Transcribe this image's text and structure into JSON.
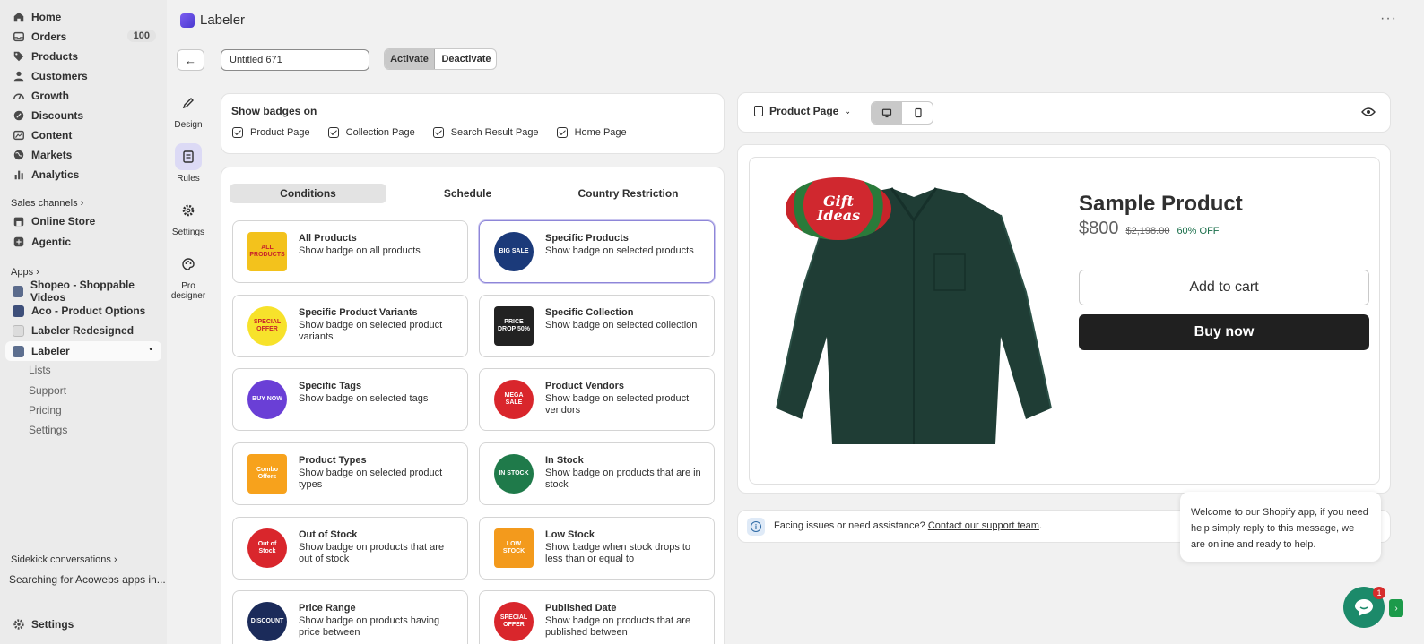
{
  "sidebar": {
    "items": [
      {
        "label": "Home",
        "icon": "home-icon"
      },
      {
        "label": "Orders",
        "icon": "orders-icon",
        "count": "100"
      },
      {
        "label": "Products",
        "icon": "tag-icon"
      },
      {
        "label": "Customers",
        "icon": "person-icon"
      },
      {
        "label": "Growth",
        "icon": "growth-icon"
      },
      {
        "label": "Discounts",
        "icon": "discount-icon"
      },
      {
        "label": "Content",
        "icon": "content-icon"
      },
      {
        "label": "Markets",
        "icon": "globe-icon"
      },
      {
        "label": "Analytics",
        "icon": "chart-icon"
      }
    ],
    "sales_channels_label": "Sales channels",
    "channels": [
      {
        "label": "Online Store"
      },
      {
        "label": "Agentic"
      }
    ],
    "apps_label": "Apps",
    "apps": [
      {
        "label": "Shopeo - Shoppable Videos"
      },
      {
        "label": "Aco - Product Options"
      },
      {
        "label": "Labeler Redesigned"
      },
      {
        "label": "Labeler"
      }
    ],
    "labeler_sub": [
      "Lists",
      "Support",
      "Pricing",
      "Settings"
    ],
    "sidekick_label": "Sidekick conversations",
    "sidekick_item": "Searching for Acowebs apps in...",
    "settings_label": "Settings"
  },
  "header": {
    "app_title": "Labeler",
    "more_icon": "more-horizontal-icon"
  },
  "toolbar": {
    "name_value": "Untitled 671",
    "activate_label": "Activate",
    "deactivate_label": "Deactivate"
  },
  "rail": [
    {
      "label": "Design",
      "icon": "pen-icon"
    },
    {
      "label": "Rules",
      "icon": "rules-icon"
    },
    {
      "label": "Settings",
      "icon": "gear-icon"
    },
    {
      "label": "Pro designer",
      "icon": "palette-icon"
    }
  ],
  "show_badges": {
    "title": "Show badges on",
    "options": [
      {
        "label": "Product Page",
        "checked": true
      },
      {
        "label": "Collection Page",
        "checked": true
      },
      {
        "label": "Search Result Page",
        "checked": true
      },
      {
        "label": "Home Page",
        "checked": true
      }
    ]
  },
  "tabs": [
    "Conditions",
    "Schedule",
    "Country Restriction"
  ],
  "conditions": [
    {
      "title": "All Products",
      "desc": "Show badge on all products",
      "badge": "ALL PRODUCTS",
      "color": "#f3c21c"
    },
    {
      "title": "Specific Products",
      "desc": "Show badge on selected products",
      "badge": "BIG SALE",
      "color": "#1b3a7a"
    },
    {
      "title": "Specific Product Variants",
      "desc": "Show badge on selected product variants",
      "badge": "SPECIAL OFFER",
      "color": "#f7e22b"
    },
    {
      "title": "Specific Collection",
      "desc": "Show badge on selected collection",
      "badge": "PRICE DROP 50%",
      "color": "#222222"
    },
    {
      "title": "Specific Tags",
      "desc": "Show badge on selected tags",
      "badge": "BUY NOW",
      "color": "#6a3fd6"
    },
    {
      "title": "Product Vendors",
      "desc": "Show badge on selected product vendors",
      "badge": "MEGA SALE",
      "color": "#d9262c"
    },
    {
      "title": "Product Types",
      "desc": "Show badge on selected product types",
      "badge": "Combo Offers",
      "color": "#f7a21c"
    },
    {
      "title": "In Stock",
      "desc": "Show badge on products that are in stock",
      "badge": "IN STOCK",
      "color": "#1f7a4a"
    },
    {
      "title": "Out of Stock",
      "desc": "Show badge on products that are out of stock",
      "badge": "Out of Stock",
      "color": "#d9262c"
    },
    {
      "title": "Low Stock",
      "desc": "Show badge when stock drops to less than or equal to",
      "badge": "LOW STOCK",
      "color": "#f39a1c"
    },
    {
      "title": "Price Range",
      "desc": "Show badge on products having price between",
      "badge": "DISCOUNT",
      "color": "#1b2b5a"
    },
    {
      "title": "Published Date",
      "desc": "Show badge on products that are published between",
      "badge": "SPECIAL OFFER",
      "color": "#d9262c"
    }
  ],
  "preview": {
    "page_select": "Product Page",
    "product_title": "Sample Product",
    "price": "$800",
    "compare_price": "$2,198.00",
    "discount": "60% OFF",
    "add_to_cart": "Add to cart",
    "buy_now": "Buy now",
    "gift_badge": "Gift Ideas",
    "accent": "#1f3d35"
  },
  "help": {
    "text": "Facing issues or need assistance?",
    "link": "Contact our support team",
    "period": "."
  },
  "chat": {
    "message": "Welcome to our Shopify app, if you need help simply reply to this message, we are online and ready to help.",
    "unread": "1"
  }
}
